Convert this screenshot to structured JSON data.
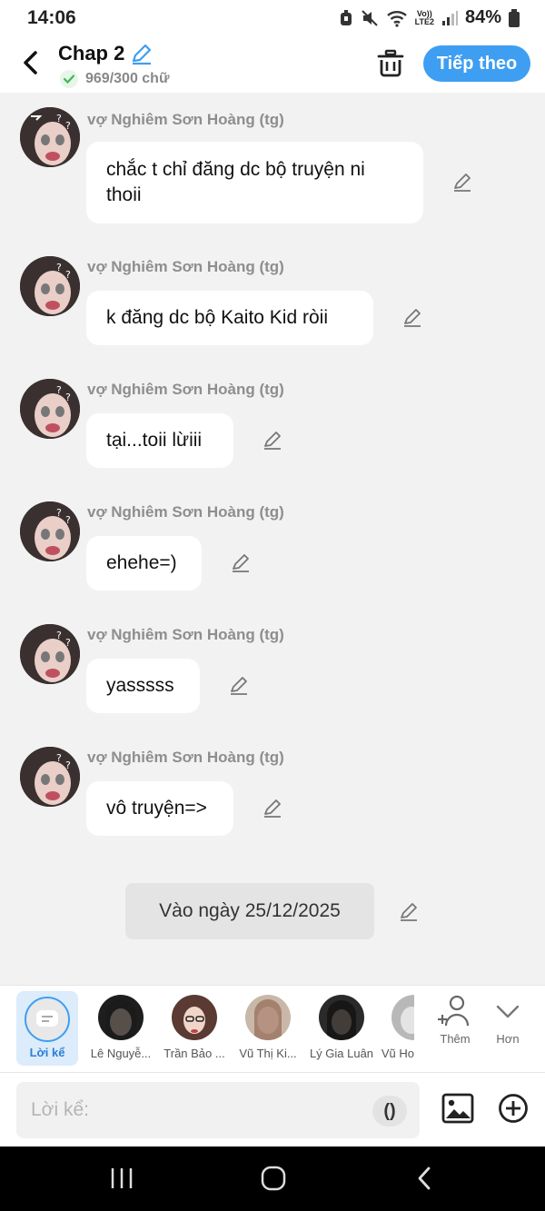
{
  "status_bar": {
    "time": "14:06",
    "network_top": "Vo))",
    "network_bottom": "LTE2",
    "battery": "84%"
  },
  "header": {
    "title": "Chap 2",
    "word_count": "969/300 chữ",
    "next_label": "Tiếp theo"
  },
  "messages": [
    {
      "author": "vợ Nghiêm Sơn Hoàng  (tg)",
      "text": "chắc t chỉ đăng dc bộ truyện ni thoii"
    },
    {
      "author": "vợ Nghiêm Sơn Hoàng  (tg)",
      "text": "k đăng dc bộ Kaito Kid ròii"
    },
    {
      "author": "vợ Nghiêm Sơn Hoàng  (tg)",
      "text": "tại...toii lừiii"
    },
    {
      "author": "vợ Nghiêm Sơn Hoàng  (tg)",
      "text": "ehehe=)"
    },
    {
      "author": "vợ Nghiêm Sơn Hoàng  (tg)",
      "text": "yasssss"
    },
    {
      "author": "vợ Nghiêm Sơn Hoàng  (tg)",
      "text": "vô truyện=>"
    }
  ],
  "date_marker": "Vào ngày 25/12/2025",
  "characters": {
    "active": "Lời kể",
    "items": [
      "Lê Nguyễ...",
      "Trần Bảo ...",
      "Vũ Thị Ki...",
      "Lý Gia Luân",
      "Vũ Ho"
    ],
    "add_label": "Thêm",
    "more_label": "Hơn"
  },
  "composer": {
    "placeholder": "Lời kể:",
    "paren_label": "()"
  },
  "colors": {
    "accent": "#3e9ef2",
    "background": "#f2f2f2",
    "bubble": "#ffffff"
  }
}
